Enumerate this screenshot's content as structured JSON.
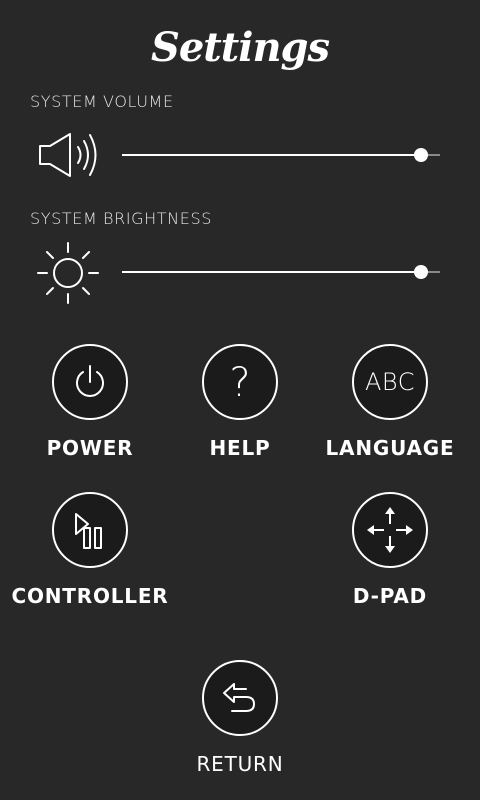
{
  "header": {
    "title": "Settings"
  },
  "volume": {
    "label": "SYSTEM VOLUME",
    "icon": "speaker-icon",
    "level": 0.94
  },
  "brightness": {
    "label": "SYSTEM BRIGHTNESS",
    "icon": "sun-icon",
    "level": 0.94
  },
  "buttons": {
    "power": {
      "label": "POWER",
      "icon": "power-icon"
    },
    "help": {
      "label": "HELP",
      "icon": "question-mark-icon",
      "glyph": "?"
    },
    "language": {
      "label": "LANGUAGE",
      "icon": "abc-icon",
      "glyph": "ABC"
    },
    "controller": {
      "label": "CONTROLLER",
      "icon": "play-pause-icon"
    },
    "dpad": {
      "label": "D-PAD",
      "icon": "four-arrows-icon"
    },
    "return": {
      "label": "RETURN",
      "icon": "return-arrow-icon"
    }
  },
  "colors": {
    "background": "#282828",
    "button_fill": "#1b1b1b",
    "foreground": "#ffffff",
    "track": "#8a8a8a"
  }
}
